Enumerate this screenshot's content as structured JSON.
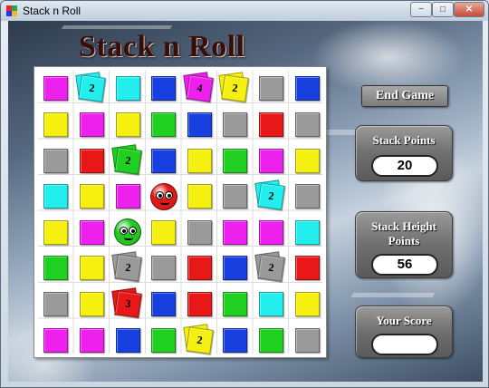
{
  "window": {
    "title": "Stack n Roll",
    "minimize": "−",
    "maximize": "□",
    "close": "✕"
  },
  "game_title": "Stack n Roll",
  "buttons": {
    "end_game": "End Game"
  },
  "panels": {
    "stack_points": {
      "label": "Stack Points",
      "value": "20"
    },
    "stack_height_points": {
      "label_line1": "Stack Height",
      "label_line2": "Points",
      "value": "56"
    },
    "your_score": {
      "label": "Your Score",
      "value": ""
    }
  },
  "colors": {
    "magenta": "#ee20ee",
    "cyan": "#22eeee",
    "blue": "#1840e0",
    "yellow": "#f5f010",
    "grey": "#9a9a9a",
    "red": "#e81818",
    "green": "#20d020"
  },
  "board": {
    "rows": [
      [
        "magenta",
        "cyan",
        "cyan",
        "blue",
        "magenta",
        "yellow",
        "grey",
        "blue"
      ],
      [
        "yellow",
        "magenta",
        "yellow",
        "green",
        "blue",
        "grey",
        "red",
        "grey"
      ],
      [
        "grey",
        "red",
        "green",
        "blue",
        "yellow",
        "green",
        "magenta",
        "yellow"
      ],
      [
        "cyan",
        "yellow",
        "magenta",
        "ball-red",
        "yellow",
        "grey",
        "cyan",
        "grey"
      ],
      [
        "yellow",
        "magenta",
        "ball-green",
        "yellow",
        "grey",
        "magenta",
        "magenta",
        "cyan"
      ],
      [
        "green",
        "yellow",
        "grey",
        "grey",
        "red",
        "blue",
        "grey",
        "red"
      ],
      [
        "grey",
        "yellow",
        "red",
        "blue",
        "red",
        "green",
        "cyan",
        "yellow"
      ],
      [
        "magenta",
        "magenta",
        "blue",
        "green",
        "yellow",
        "blue",
        "green",
        "grey"
      ]
    ],
    "stacks": [
      {
        "row": 0,
        "col": 1,
        "height": "2",
        "top": "cyan"
      },
      {
        "row": 0,
        "col": 4,
        "height": "4",
        "top": "magenta"
      },
      {
        "row": 0,
        "col": 5,
        "height": "2",
        "top": "yellow"
      },
      {
        "row": 2,
        "col": 2,
        "height": "2",
        "top": "green"
      },
      {
        "row": 3,
        "col": 6,
        "height": "2",
        "top": "cyan"
      },
      {
        "row": 5,
        "col": 2,
        "height": "2",
        "top": "grey"
      },
      {
        "row": 5,
        "col": 6,
        "height": "2",
        "top": "grey"
      },
      {
        "row": 6,
        "col": 2,
        "height": "3",
        "top": "red"
      },
      {
        "row": 7,
        "col": 4,
        "height": "2",
        "top": "yellow"
      }
    ]
  }
}
